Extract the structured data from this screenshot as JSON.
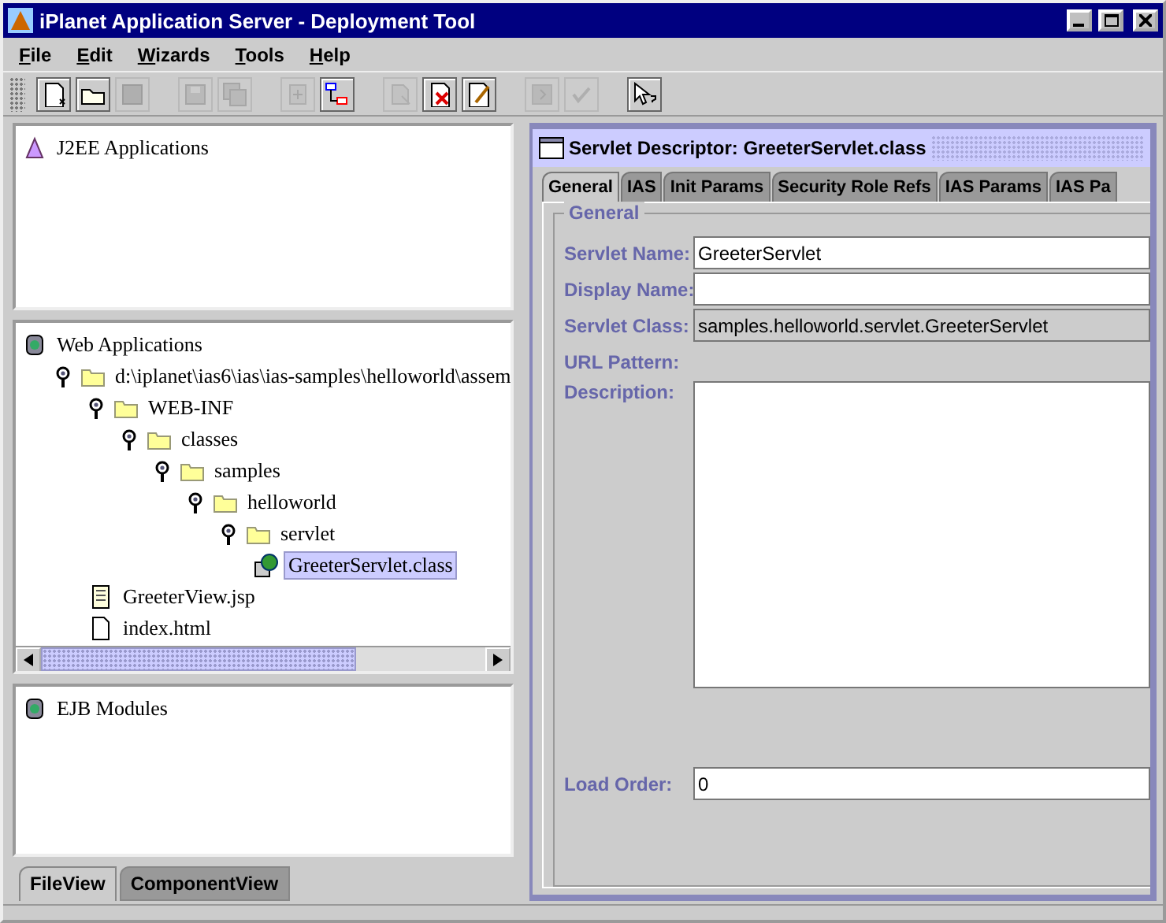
{
  "window": {
    "title": "iPlanet Application Server - Deployment Tool"
  },
  "menu": [
    "File",
    "Edit",
    "Wizards",
    "Tools",
    "Help"
  ],
  "toolbar": [
    {
      "buttons": [
        {
          "kind": "new",
          "disabled": false
        },
        {
          "kind": "open",
          "disabled": false
        },
        {
          "kind": "save_as",
          "disabled": true
        }
      ]
    },
    {
      "buttons": [
        {
          "kind": "save",
          "disabled": true
        },
        {
          "kind": "save_all",
          "disabled": true
        }
      ]
    },
    {
      "buttons": [
        {
          "kind": "add",
          "disabled": true
        },
        {
          "kind": "layout",
          "disabled": false
        }
      ]
    },
    {
      "buttons": [
        {
          "kind": "find",
          "disabled": true
        },
        {
          "kind": "remove",
          "disabled": false
        },
        {
          "kind": "edit",
          "disabled": false
        }
      ]
    },
    {
      "buttons": [
        {
          "kind": "deploy",
          "disabled": true
        },
        {
          "kind": "verify",
          "disabled": true
        }
      ]
    },
    {
      "buttons": [
        {
          "kind": "context_help",
          "disabled": false
        }
      ]
    }
  ],
  "left_panes": [
    {
      "root": {
        "label": "J2EE Applications",
        "kind": "app"
      }
    },
    {
      "root": {
        "label": "Web Applications",
        "kind": "jar",
        "children": [
          {
            "label": "d:\\iplanet\\ias6\\ias\\ias-samples\\helloworld\\assem",
            "kind": "folder",
            "expanded": true,
            "selected": false,
            "children": [
              {
                "label": "WEB-INF",
                "kind": "folder",
                "expanded": true,
                "selected": false,
                "children": [
                  {
                    "label": "classes",
                    "kind": "folder",
                    "expanded": true,
                    "selected": false,
                    "children": [
                      {
                        "label": "samples",
                        "kind": "folder",
                        "expanded": true,
                        "selected": false,
                        "children": [
                          {
                            "label": "helloworld",
                            "kind": "folder",
                            "expanded": true,
                            "selected": false,
                            "children": [
                              {
                                "label": "servlet",
                                "kind": "folder",
                                "expanded": true,
                                "selected": false,
                                "children": [
                                  {
                                    "label": "GreeterServlet.class",
                                    "kind": "servlet",
                                    "selected": true
                                  }
                                ]
                              }
                            ]
                          }
                        ]
                      }
                    ]
                  }
                ]
              },
              {
                "label": "GreeterView.jsp",
                "kind": "jsp",
                "selected": false
              },
              {
                "label": "index.html",
                "kind": "file",
                "selected": false
              }
            ]
          }
        ]
      },
      "scrollbar": true
    },
    {
      "root": {
        "label": "EJB Modules",
        "kind": "jar"
      }
    }
  ],
  "left_tabs": [
    {
      "label": "FileView",
      "selected": true
    },
    {
      "label": "ComponentView",
      "selected": false
    }
  ],
  "descriptor": {
    "title": "Servlet Descriptor: GreeterServlet.class",
    "tabs": [
      {
        "label": "General",
        "selected": true
      },
      {
        "label": "IAS",
        "selected": false
      },
      {
        "label": "Init Params",
        "selected": false
      },
      {
        "label": "Security Role Refs",
        "selected": false
      },
      {
        "label": "IAS Params",
        "selected": false
      },
      {
        "label": "IAS Pa",
        "selected": false
      }
    ],
    "group_title": "General",
    "fields": [
      {
        "label": "Servlet Name:",
        "kind": "text",
        "value": "GreeterServlet",
        "disabled": false
      },
      {
        "label": "Display Name:",
        "kind": "text",
        "disabled": false
      },
      {
        "label": "Servlet Class:",
        "kind": "text",
        "value": "samples.helloworld.servlet.GreeterServlet",
        "disabled": true
      },
      {
        "label": "URL Pattern:",
        "kind": "none"
      },
      {
        "label": "Description:",
        "kind": "textarea"
      },
      {
        "label": "Load Order:",
        "kind": "text",
        "value": "0",
        "disabled": false
      }
    ]
  }
}
